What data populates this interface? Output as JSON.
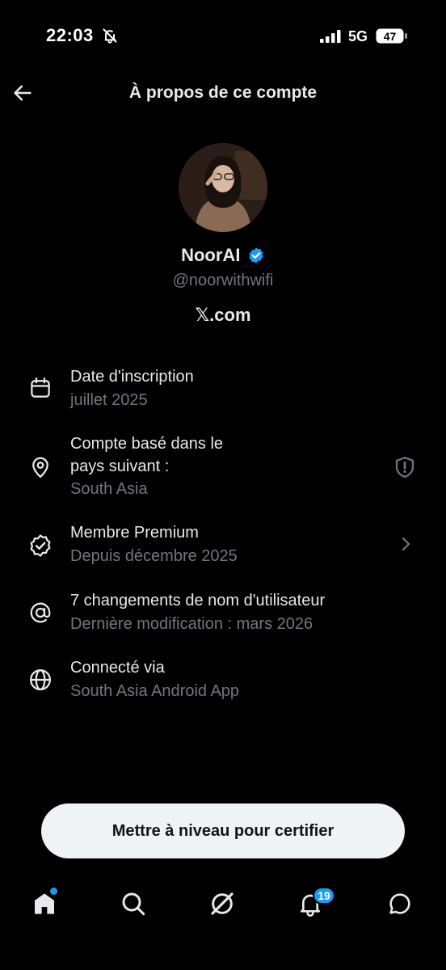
{
  "status_bar": {
    "time": "22:03",
    "network": "5G",
    "battery": "47"
  },
  "header": {
    "title": "À propos de ce compte"
  },
  "profile": {
    "name": "NoorAI",
    "handle": "@noorwithwifi",
    "site": "𝕏.com"
  },
  "details": [
    {
      "icon": "calendar-icon",
      "title": "Date d'inscription",
      "subtitle": "juillet 2025"
    },
    {
      "icon": "location-pin-icon",
      "title_line1": "Compte basé dans le",
      "title_line2": "pays suivant :",
      "subtitle": "South Asia"
    },
    {
      "icon": "verified-badge-icon",
      "title": "Membre Premium",
      "subtitle": "Depuis décembre 2025"
    },
    {
      "icon": "at-sign-icon",
      "title": "7 changements de nom d'utilisateur",
      "subtitle": "Dernière modification : mars 2026"
    },
    {
      "icon": "globe-icon",
      "title": "Connecté via",
      "subtitle": "South Asia Android App"
    }
  ],
  "cta": {
    "label": "Mettre à niveau pour certifier"
  },
  "bottom_nav": {
    "notifications_count": "19"
  },
  "colors": {
    "accent": "#1d9bf0",
    "background": "#000000",
    "text": "#e7e9ea",
    "muted": "#71767b"
  }
}
